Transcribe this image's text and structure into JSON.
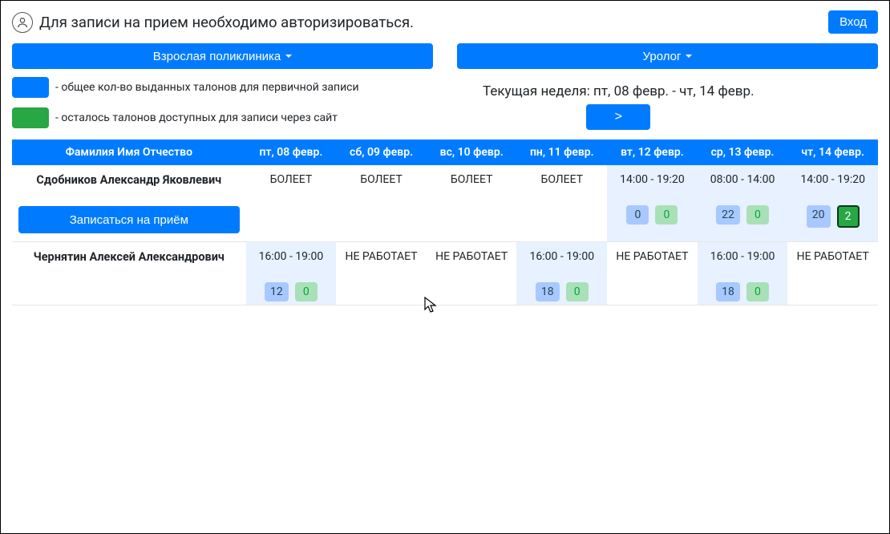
{
  "auth": {
    "message": "Для записи на прием необходимо авторизироваться.",
    "login_label": "Вход"
  },
  "selectors": {
    "department": "Взрослая поликлиника",
    "specialty": "Уролог"
  },
  "legend": {
    "blue": "- общее кол-во выданных талонов для первичной записи",
    "green": "- осталось талонов доступных для записи через сайт"
  },
  "week": {
    "label": "Текущая неделя: пт, 08 февр. - чт, 14 февр.",
    "next_label": ">"
  },
  "table": {
    "col_name": "Фамилия Имя Отчество",
    "days": [
      "пт, 08 февр.",
      "сб, 09 февр.",
      "вс, 10 февр.",
      "пн, 11 февр.",
      "вт, 12 февр.",
      "ср, 13 февр.",
      "чт, 14 февр."
    ]
  },
  "appoint_label": "Записаться на приём",
  "doctors": [
    {
      "name": "Сдобников Александр Яковлевич",
      "has_appoint_button": true,
      "days": [
        {
          "status": "БОЛЕЕТ"
        },
        {
          "status": "БОЛЕЕТ"
        },
        {
          "status": "БОЛЕЕТ"
        },
        {
          "status": "БОЛЕЕТ"
        },
        {
          "time": "14:00 - 19:20",
          "total": "0",
          "free": "0"
        },
        {
          "time": "08:00 - 14:00",
          "total": "22",
          "free": "0"
        },
        {
          "time": "14:00 - 19:20",
          "total": "20",
          "free": "2",
          "free_active": true
        }
      ]
    },
    {
      "name": "Чернятин Алексей Александрович",
      "has_appoint_button": false,
      "days": [
        {
          "time": "16:00 - 19:00",
          "total": "12",
          "free": "0"
        },
        {
          "status": "НЕ РАБОТАЕТ"
        },
        {
          "status": "НЕ РАБОТАЕТ"
        },
        {
          "time": "16:00 - 19:00",
          "total": "18",
          "free": "0"
        },
        {
          "status": "НЕ РАБОТАЕТ"
        },
        {
          "time": "16:00 - 19:00",
          "total": "18",
          "free": "0"
        },
        {
          "status": "НЕ РАБОТАЕТ"
        }
      ]
    }
  ]
}
